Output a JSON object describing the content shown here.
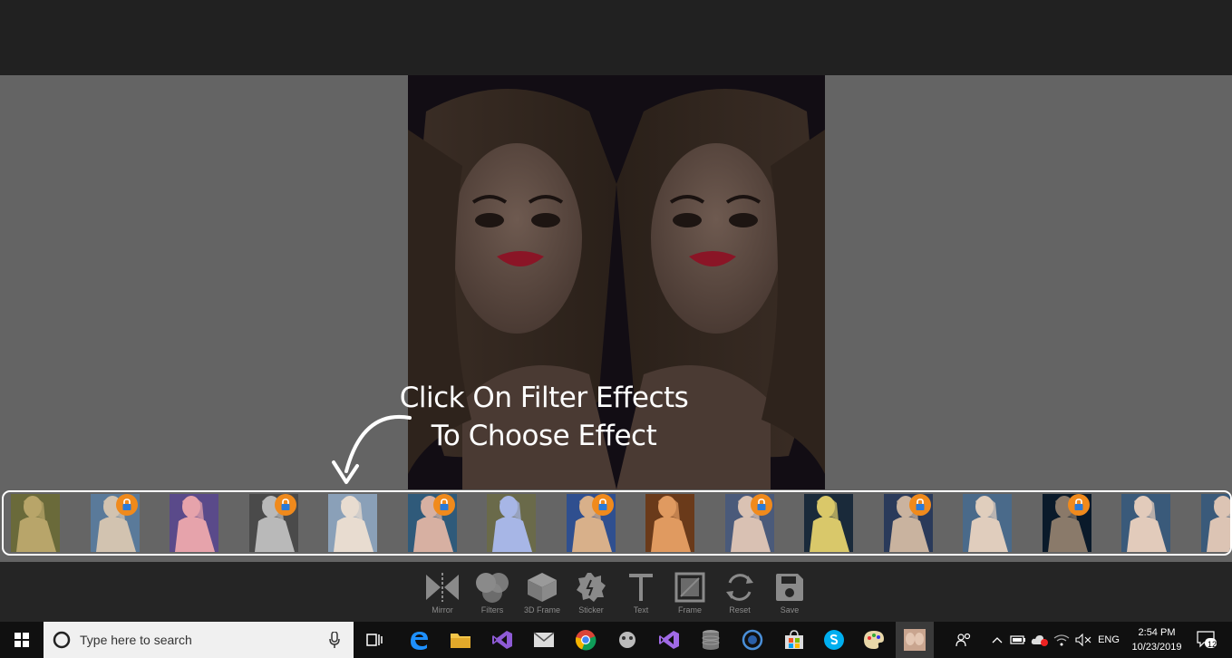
{
  "hint": {
    "line1": "Click On Filter Effects",
    "line2": "To Choose Effect"
  },
  "filters": {
    "thumbs": [
      {
        "tint": "#b8a56a",
        "bg": "#6a6a3a",
        "locked": false
      },
      {
        "tint": "#d2c3b0",
        "bg": "#5a7a9a",
        "locked": true
      },
      {
        "tint": "#e6a3ab",
        "bg": "#5a4a8a",
        "locked": false
      },
      {
        "tint": "#b9b9b9",
        "bg": "#4a4a4a",
        "locked": true
      },
      {
        "tint": "#e8dcd0",
        "bg": "#8aa0b8",
        "locked": false
      },
      {
        "tint": "#d7b0a2",
        "bg": "#2f5a7a",
        "locked": true
      },
      {
        "tint": "#a7b6e6",
        "bg": "#6a6a4a",
        "locked": false
      },
      {
        "tint": "#d8b08a",
        "bg": "#2f4f8f",
        "locked": true
      },
      {
        "tint": "#e09a60",
        "bg": "#6a3a1a",
        "locked": false
      },
      {
        "tint": "#d9c1b3",
        "bg": "#4a5a7a",
        "locked": true
      },
      {
        "tint": "#d9c86a",
        "bg": "#1a2a3a",
        "locked": false
      },
      {
        "tint": "#c9b39f",
        "bg": "#2a3a5a",
        "locked": true
      },
      {
        "tint": "#e0cdbd",
        "bg": "#4a6a8a",
        "locked": false
      },
      {
        "tint": "#8a7a6a",
        "bg": "#0a1a2a",
        "locked": true
      },
      {
        "tint": "#e2cbbb",
        "bg": "#3a5a7a",
        "locked": false
      },
      {
        "tint": "#dcc4b4",
        "bg": "#3a5a7a",
        "locked": false
      }
    ]
  },
  "toolbar": {
    "mirror": "Mirror",
    "filters": "Filters",
    "frame3d": "3D Frame",
    "sticker": "Sticker",
    "text": "Text",
    "frame": "Frame",
    "reset": "Reset",
    "save": "Save"
  },
  "taskbar": {
    "search_placeholder": "Type here to search",
    "language": "ENG",
    "time": "2:54 PM",
    "date": "10/23/2019",
    "notifications": "12"
  },
  "colors": {
    "lock": "#f08a1c",
    "canvas_bg": "#646464",
    "toolbar_bg": "#252525",
    "taskbar_bg": "#101010"
  }
}
